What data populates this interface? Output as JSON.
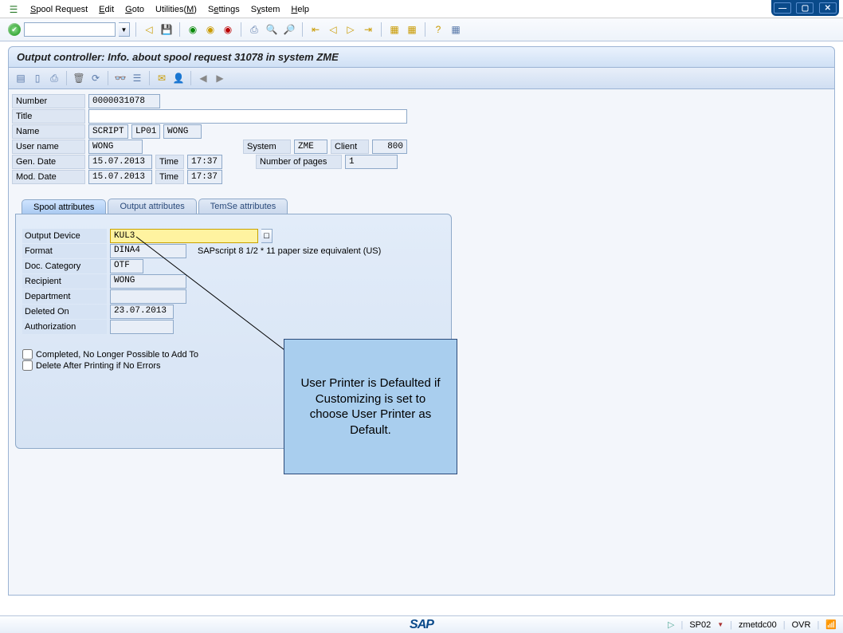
{
  "window": {
    "min": "—",
    "max": "▢",
    "close": "✕"
  },
  "menu": {
    "spool_request": "Spool Request",
    "edit": "Edit",
    "goto": "Goto",
    "utilities": "Utilities(M)",
    "settings": "Settings",
    "system": "System",
    "help": "Help"
  },
  "title": "Output controller: Info. about spool request 31078 in system ZME",
  "header": {
    "number_label": "Number",
    "number": "0000031078",
    "title_label": "Title",
    "title_val": "",
    "name_label": "Name",
    "name1": "SCRIPT",
    "name2": "LP01",
    "name3": "WONG",
    "user_label": "User name",
    "user": "WONG",
    "system_label": "System",
    "system": "ZME",
    "client_label": "Client",
    "client": "800",
    "gendate_label": "Gen. Date",
    "gendate": "15.07.2013",
    "gentime_label": "Time",
    "gentime": "17:37",
    "pages_label": "Number of pages",
    "pages": "1",
    "moddate_label": "Mod. Date",
    "moddate": "15.07.2013",
    "modtime_label": "Time",
    "modtime": "17:37"
  },
  "tabs": {
    "t1": "Spool attributes",
    "t2": "Output attributes",
    "t3": "TemSe attributes"
  },
  "attrs": {
    "outdev_label": "Output Device",
    "outdev": "KUL3",
    "format_label": "Format",
    "format": "DINA4",
    "format_desc": "SAPscript 8 1/2 * 11 paper size equivalent (US)",
    "doccat_label": "Doc. Category",
    "doccat": "OTF",
    "recip_label": "Recipient",
    "recip": "WONG",
    "dept_label": "Department",
    "dept": "",
    "deleted_label": "Deleted On",
    "deleted": "23.07.2013",
    "auth_label": "Authorization",
    "auth": "",
    "chk1": "Completed, No Longer Possible to Add To",
    "chk2": "Delete After Printing if No Errors"
  },
  "callout": "User Printer is Defaulted if Customizing is set to choose User Printer as Default.",
  "status": {
    "sp": "SP02",
    "sys": "zmetdc00",
    "mode": "OVR",
    "sap": "SAP"
  }
}
